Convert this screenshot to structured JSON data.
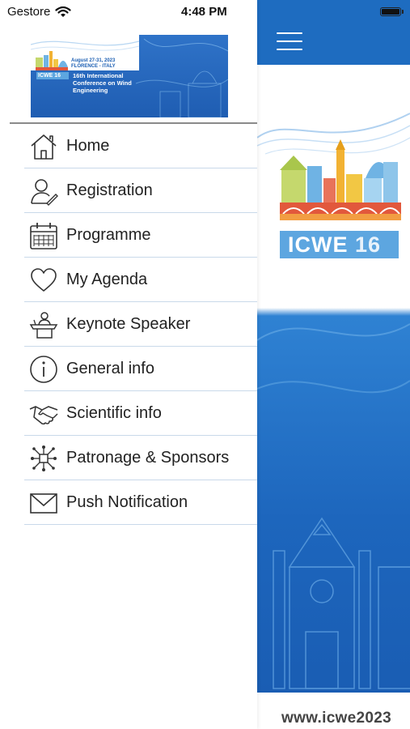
{
  "status_bar": {
    "carrier": "Gestore",
    "time": "4:48 PM"
  },
  "banner": {
    "date": "August 27-31, 2023",
    "location": "FLORENCE - ITALY",
    "badge": "ICWE 16",
    "title": "16th International Conference on Wind Engineering"
  },
  "menu": {
    "items": [
      {
        "label": "Home",
        "icon": "home-icon"
      },
      {
        "label": "Registration",
        "icon": "user-pen-icon"
      },
      {
        "label": "Programme",
        "icon": "calendar-icon"
      },
      {
        "label": "My Agenda",
        "icon": "heart-icon"
      },
      {
        "label": "Keynote Speaker",
        "icon": "speaker-podium-icon"
      },
      {
        "label": "General info",
        "icon": "info-icon"
      },
      {
        "label": "Scientific info",
        "icon": "handshake-icon"
      },
      {
        "label": "Patronage & Sponsors",
        "icon": "network-icon"
      },
      {
        "label": "Push Notification",
        "icon": "envelope-icon"
      }
    ]
  },
  "background_app": {
    "badge_text": "ICWE",
    "badge_number": "16",
    "footer_url": "www.icwe2023"
  },
  "colors": {
    "brand_blue": "#1e6cc0",
    "badge_blue": "#5da6e0",
    "divider": "#c9d9ea"
  }
}
